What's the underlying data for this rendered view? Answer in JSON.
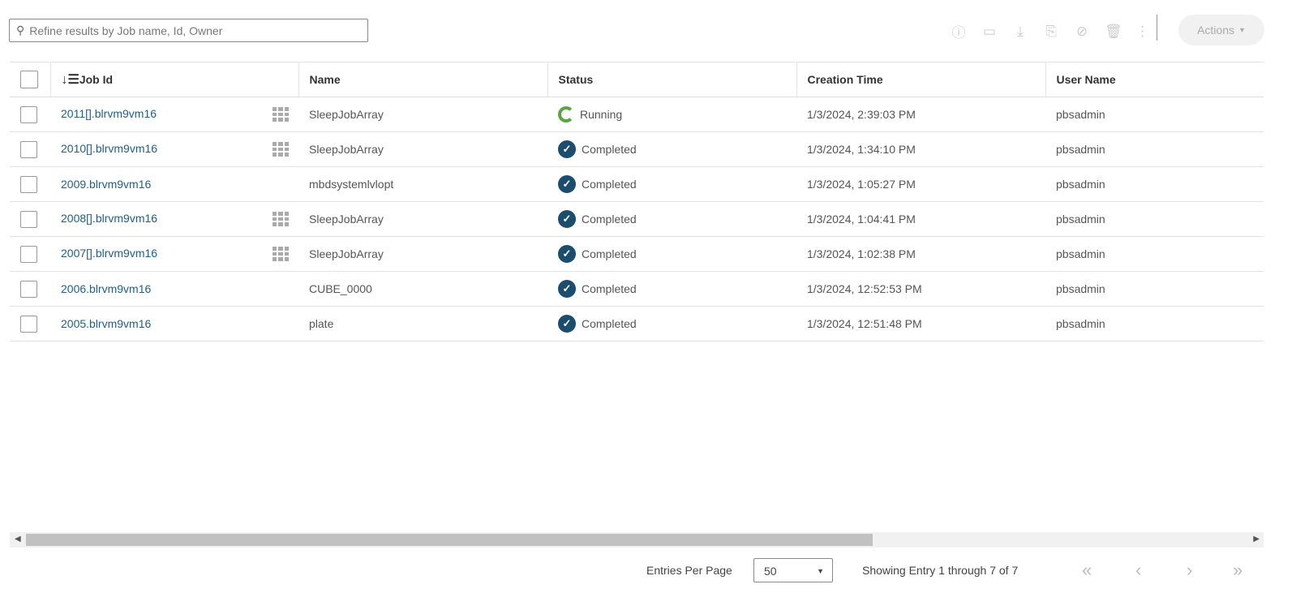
{
  "search": {
    "placeholder": "Refine results by Job name, Id, Owner",
    "value": ""
  },
  "toolbar": {
    "icons": [
      "info-icon",
      "display-icon",
      "download-icon",
      "clone-icon",
      "cancel-icon",
      "delete-icon",
      "more-icon"
    ],
    "actions_label": "Actions"
  },
  "table": {
    "columns": [
      "Job Id",
      "Name",
      "Status",
      "Creation Time",
      "User Name"
    ],
    "rows": [
      {
        "id": "2011[].blrvm9vm16",
        "array": true,
        "name": "SleepJobArray",
        "status": "Running",
        "time": "1/3/2024, 2:39:03 PM",
        "user": "pbsadmin"
      },
      {
        "id": "2010[].blrvm9vm16",
        "array": true,
        "name": "SleepJobArray",
        "status": "Completed",
        "time": "1/3/2024, 1:34:10 PM",
        "user": "pbsadmin"
      },
      {
        "id": "2009.blrvm9vm16",
        "array": false,
        "name": "mbdsystemlvlopt",
        "status": "Completed",
        "time": "1/3/2024, 1:05:27 PM",
        "user": "pbsadmin"
      },
      {
        "id": "2008[].blrvm9vm16",
        "array": true,
        "name": "SleepJobArray",
        "status": "Completed",
        "time": "1/3/2024, 1:04:41 PM",
        "user": "pbsadmin"
      },
      {
        "id": "2007[].blrvm9vm16",
        "array": true,
        "name": "SleepJobArray",
        "status": "Completed",
        "time": "1/3/2024, 1:02:38 PM",
        "user": "pbsadmin"
      },
      {
        "id": "2006.blrvm9vm16",
        "array": false,
        "name": "CUBE_0000",
        "status": "Completed",
        "time": "1/3/2024, 12:52:53 PM",
        "user": "pbsadmin"
      },
      {
        "id": "2005.blrvm9vm16",
        "array": false,
        "name": "plate",
        "status": "Completed",
        "time": "1/3/2024, 12:51:48 PM",
        "user": "pbsadmin"
      }
    ]
  },
  "footer": {
    "entries_label": "Entries Per Page",
    "entries_value": "50",
    "showing": "Showing Entry 1 through 7 of 7",
    "first": "«",
    "prev": "‹",
    "next": "›",
    "last": "»"
  }
}
